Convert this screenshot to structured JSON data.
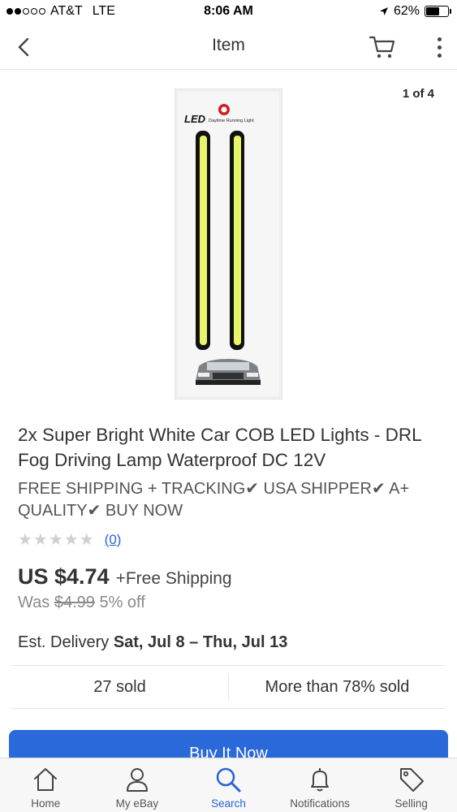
{
  "status_bar": {
    "carrier": "AT&T",
    "network": "LTE",
    "time": "8:06 AM",
    "battery_percent": "62%",
    "battery_level": 0.62
  },
  "header": {
    "title": "Item"
  },
  "gallery": {
    "counter": "1 of 4",
    "image_label": "LED",
    "image_sublabel": "Daytime Running Light"
  },
  "product": {
    "title": "2x Super Bright White Car COB LED Lights - DRL Fog Driving Lamp Waterproof DC 12V",
    "subtitle": "FREE SHIPPING + TRACKING✔ USA SHIPPER✔ A+ QUALITY✔ BUY NOW",
    "stars": "★★★★★",
    "rating_value": 0,
    "rating_count": "(0)",
    "price": "US $4.74",
    "shipping": "+Free Shipping",
    "was_label": "Was",
    "was_price": "$4.99",
    "discount": "5% off",
    "delivery_label": "Est. Delivery",
    "delivery_dates": "Sat, Jul 8 – Thu, Jul 13"
  },
  "sold": {
    "count": "27 sold",
    "percent": "More than 78% sold"
  },
  "buy_button": {
    "label": "Buy It Now"
  },
  "tabs": [
    {
      "label": "Home",
      "icon": "home-icon"
    },
    {
      "label": "My eBay",
      "icon": "person-icon"
    },
    {
      "label": "Search",
      "icon": "search-icon"
    },
    {
      "label": "Notifications",
      "icon": "bell-icon"
    },
    {
      "label": "Selling",
      "icon": "tag-icon"
    }
  ],
  "colors": {
    "accent": "#2962d6",
    "buy_button": "#2969d9",
    "led_strip": "#e8f56a"
  }
}
